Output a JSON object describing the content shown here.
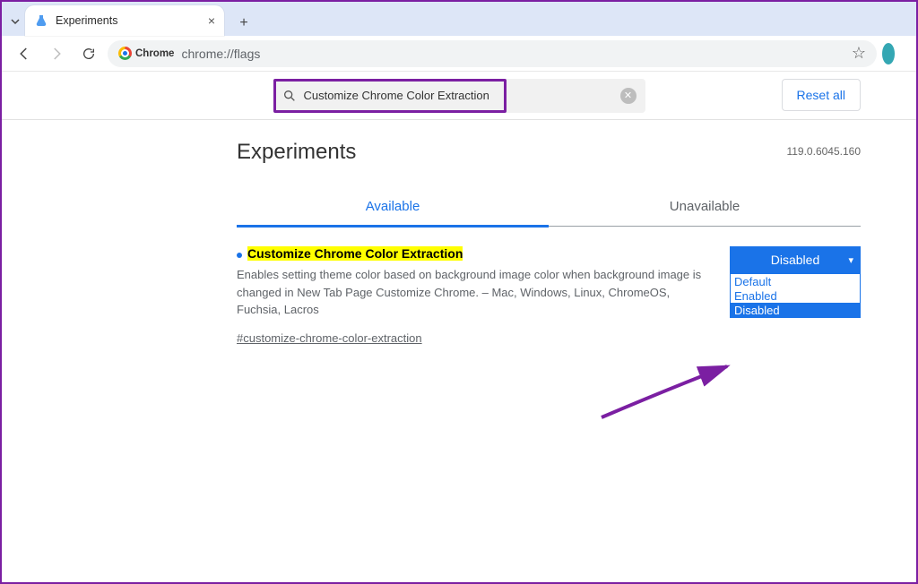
{
  "browser": {
    "tab_title": "Experiments",
    "url": "chrome://flags",
    "omnibox_label": "Chrome"
  },
  "toolbar_icons": {
    "back": "←",
    "forward": "→",
    "reload": "⟳"
  },
  "page": {
    "search_value": "Customize Chrome Color Extraction",
    "reset_label": "Reset all",
    "heading": "Experiments",
    "version": "119.0.6045.160",
    "tabs": {
      "available": "Available",
      "unavailable": "Unavailable"
    },
    "flag": {
      "title": "Customize Chrome Color Extraction",
      "description": "Enables setting theme color based on background image color when background image is changed in New Tab Page Customize Chrome. – Mac, Windows, Linux, ChromeOS, Fuchsia, Lacros",
      "hash": "#customize-chrome-color-extraction",
      "selected": "Disabled",
      "options": [
        "Default",
        "Enabled",
        "Disabled"
      ]
    }
  }
}
